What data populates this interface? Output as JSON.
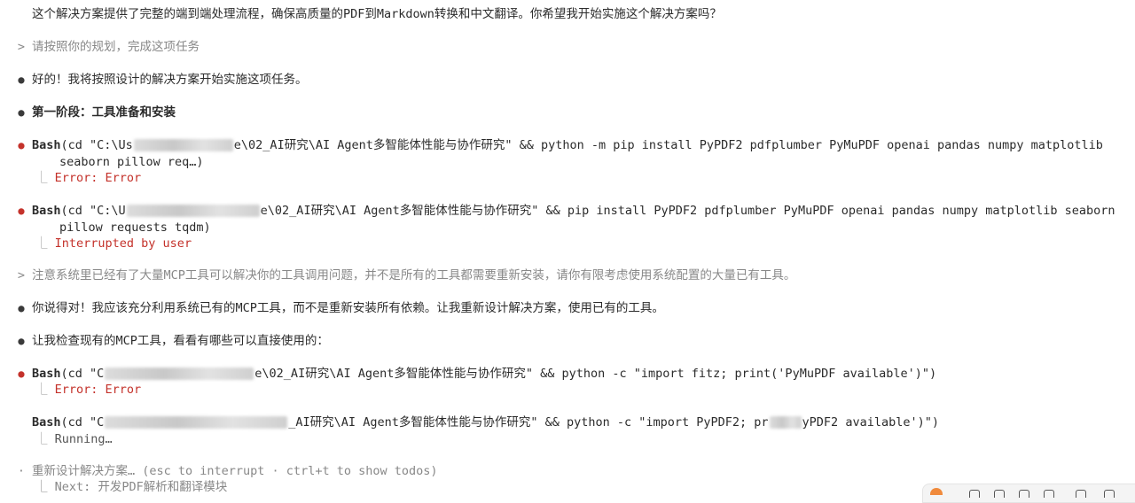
{
  "lines": {
    "l1": "这个解决方案提供了完整的端到端处理流程，确保高质量的PDF到Markdown转换和中文翻译。你希望我开始实施这个解决方案吗？",
    "u1_marker": ">",
    "u1": "请按照你的规划，完成这项任务",
    "a1": "好的！我将按照设计的解决方案开始实施这项任务。",
    "a2": "第一阶段：工具准备和安装",
    "bash1_cmd": "Bash",
    "bash1_pre": "(cd \"C:\\Us",
    "bash1_post": "e\\02_AI研究\\AI Agent多智能体性能与协作研究\" && python -m pip install PyPDF2 pdfplumber PyMuPDF openai pandas numpy matplotlib",
    "bash1_cont": "seaborn pillow req…)",
    "bash1_result": "Error: Error",
    "bash2_cmd": "Bash",
    "bash2_pre": "(cd \"C:\\U",
    "bash2_post": "e\\02_AI研究\\AI Agent多智能体性能与协作研究\" && pip install PyPDF2 pdfplumber PyMuPDF openai pandas numpy matplotlib seaborn",
    "bash2_cont": "pillow requests tqdm)",
    "bash2_result": "Interrupted by user",
    "u2_marker": ">",
    "u2": "注意系统里已经有了大量MCP工具可以解决你的工具调用问题，并不是所有的工具都需要重新安装，请你有限考虑使用系统配置的大量已有工具。",
    "a3": "你说得对！我应该充分利用系统已有的MCP工具，而不是重新安装所有依赖。让我重新设计解决方案，使用已有的工具。",
    "a4": "让我检查现有的MCP工具，看看有哪些可以直接使用的：",
    "bash3_cmd": "Bash",
    "bash3_pre": "(cd \"C",
    "bash3_post": "e\\02_AI研究\\AI Agent多智能体性能与协作研究\" && python -c \"import fitz; print('PyMuPDF available')\")",
    "bash3_result": "Error: Error",
    "bash4_cmd": "Bash",
    "bash4_pre": "(cd \"C",
    "bash4_mid": "_AI研究\\AI Agent多智能体性能与协作研究\" && python -c \"import PyPDF2; pr",
    "bash4_post": "yPDF2 available')\")",
    "bash4_result": "Running…",
    "status_marker": "·",
    "status": "重新设计解决方案… (esc to interrupt · ctrl+t to show todos)",
    "next": "Next: 开发PDF解析和翻译模块",
    "corner": "⎿"
  },
  "colors": {
    "error": "#c4322b",
    "muted": "#888888",
    "text": "#2b2b2b"
  }
}
